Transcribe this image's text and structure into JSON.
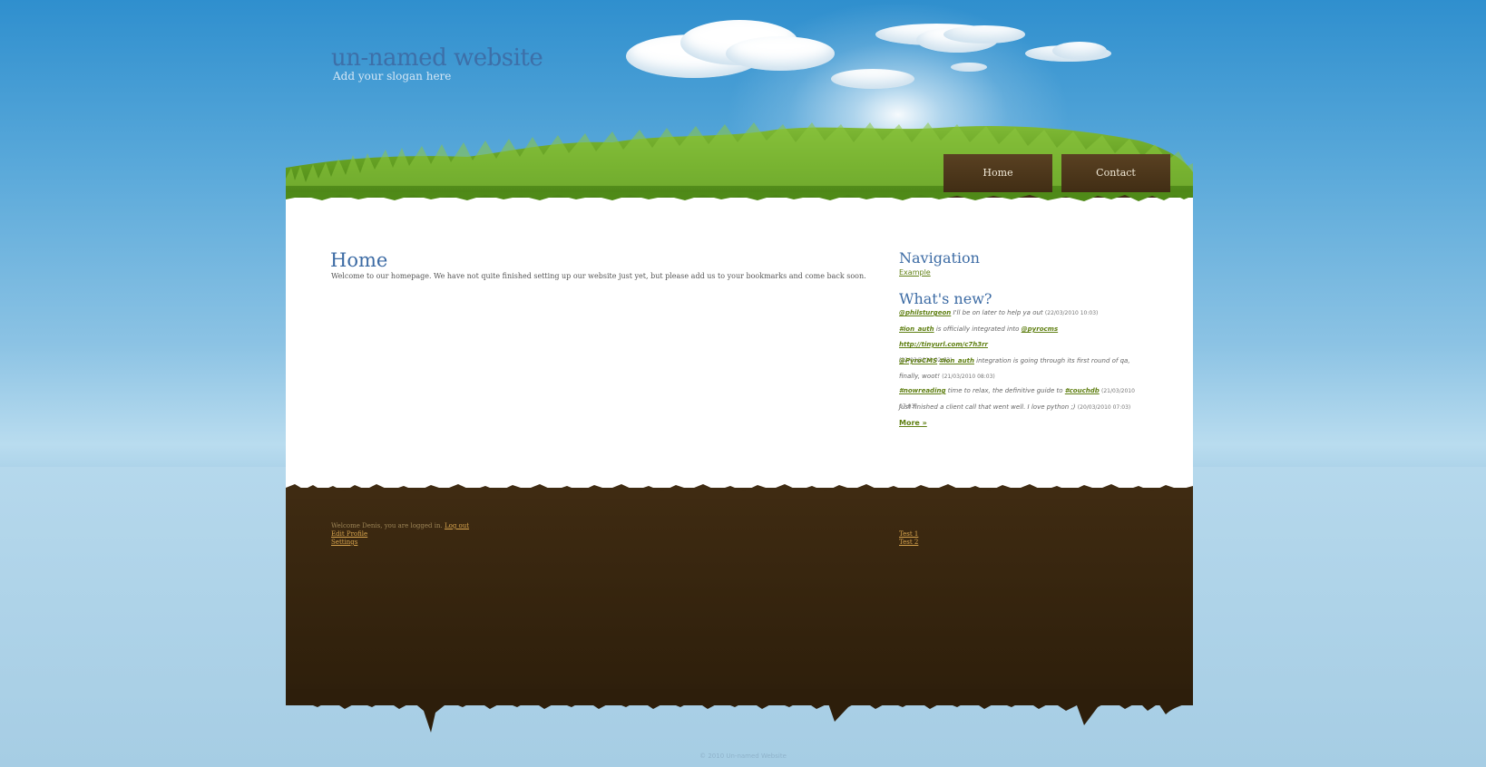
{
  "header": {
    "site_title": "un-named website",
    "slogan": "Add your slogan here"
  },
  "nav": {
    "tabs": [
      {
        "label": "Home"
      },
      {
        "label": "Contact"
      }
    ]
  },
  "main": {
    "heading": "Home",
    "intro": "Welcome to our homepage. We have not quite finished setting up our website just yet, but please add us to your bookmarks and come back soon."
  },
  "sidebar": {
    "navigation_heading": "Navigation",
    "navigation_links": [
      {
        "label": "Example"
      }
    ],
    "whats_new_heading": "What's new?",
    "tweets": [
      {
        "link": "@philsturgeon",
        "text": " I'll be on later to help ya out",
        "date": "(22/03/2010 10:03)"
      },
      {
        "link": "#ion_auth",
        "text": " is officially integrated into ",
        "link2": "@pyrocms",
        "link3": "http://tinyurl.com/c7h3rr",
        "date": "(22/03/2010 02:03)"
      },
      {
        "link": "@PyroCMS",
        "link2": "#ion_auth",
        "text": " integration is going through its first round of qa, finally, woot!",
        "date": "(21/03/2010 08:03)"
      },
      {
        "link": "#nowreading",
        "text": " time to relax, the definitive guide to ",
        "link2": "#couchdb",
        "date": "(21/03/2010 07:03)"
      },
      {
        "text": "Just finished a client call that went well. I love python ;)",
        "date": "(20/03/2010 07:03)"
      }
    ],
    "more_link": "More »"
  },
  "footer": {
    "welcome_text": "Welcome Denis, you are logged in.",
    "logout_link": "Log out",
    "edit_profile_link": "Edit Profile",
    "settings_link": "Settings",
    "test_links": [
      {
        "label": "Test 1"
      },
      {
        "label": "Test 2"
      }
    ],
    "copyright": "© 2010 Un-named Website"
  },
  "colors": {
    "sky": "#2f8fce",
    "heading_blue": "#3c6ba4",
    "link_green": "#5f7f12",
    "soil_brown": "#3f2b12",
    "footer_link": "#d7a44e"
  }
}
